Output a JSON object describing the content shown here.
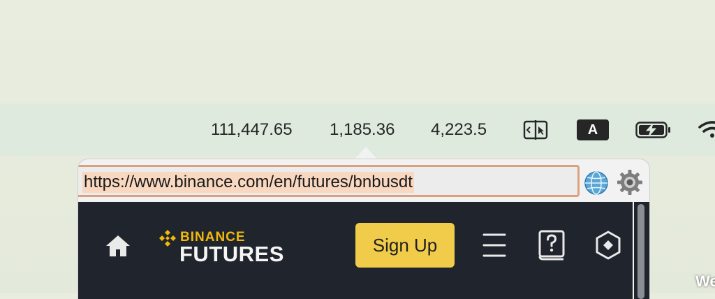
{
  "menubar": {
    "prices": [
      "111,447.65",
      "1,185.36",
      "4,223.5"
    ],
    "keyboard_input_label": "A",
    "icons": [
      "window-split-icon",
      "keyboard-input-icon",
      "battery-charging-icon",
      "wifi-icon"
    ]
  },
  "popup": {
    "url": "https://www.binance.com/en/futures/bnbusdt",
    "icons": [
      "globe-icon",
      "settings-gear-icon"
    ]
  },
  "webpage": {
    "logo_top": "BINANCE",
    "logo_bottom": "FUTURES",
    "signup_label": "Sign Up",
    "icons": [
      "home-icon",
      "menu-icon",
      "help-book-icon",
      "hex-diamond-icon"
    ]
  },
  "desktop": {
    "corner_text": "We"
  },
  "colors": {
    "accent": "#f0b90b",
    "signup_bg": "#f0cc4a",
    "page_bg": "#20242c",
    "url_highlight": "#f8d8c0"
  }
}
